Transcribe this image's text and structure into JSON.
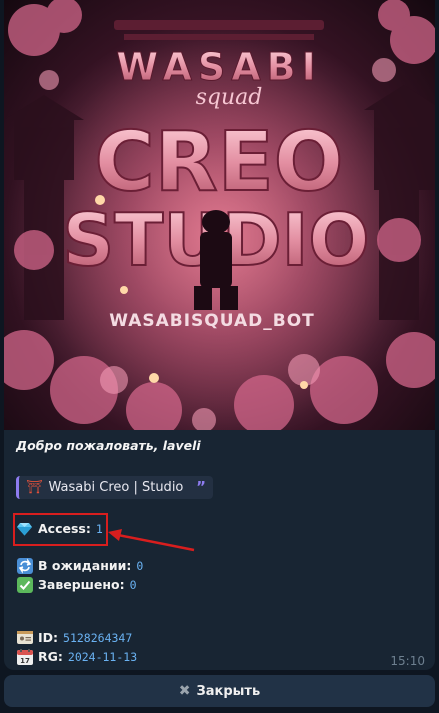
{
  "banner": {
    "logo_top": "WASABI",
    "logo_script": "squad",
    "logo_main_1": "CREO",
    "logo_main_2": "STUDIO",
    "logo_handle": "WASABISQUAD_BOT"
  },
  "message": {
    "welcome": "Добро пожаловать, laveli",
    "quote_label": "Wasabi Creo | Studio",
    "quote_icon": "torii-gate-icon",
    "access_label": "Access:",
    "access_value": "1",
    "pending_label": "В ожидании:",
    "pending_value": "0",
    "done_label": "Завершено:",
    "done_value": "0",
    "id_label": "ID:",
    "id_value": "5128264347",
    "rg_label": "RG:",
    "rg_value": "2024-11-13",
    "time": "15:10"
  },
  "button": {
    "close_label": "Закрыть"
  },
  "colors": {
    "background": "#0e1621",
    "bubble": "#182533",
    "link": "#6ab2f2",
    "highlight": "#d81e1e",
    "arrow": "#d81e1e"
  }
}
